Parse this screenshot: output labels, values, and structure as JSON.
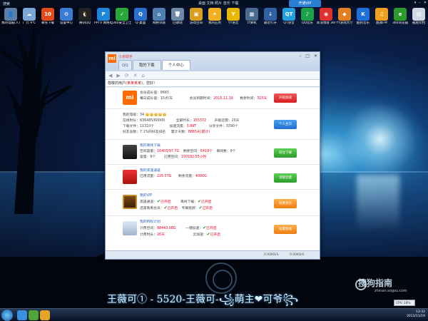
{
  "topbar": {
    "left": "搜索",
    "center": "桌面  文档  照片  音乐  下载",
    "vip": "开通VIP",
    "window_controls": [
      "▾",
      "–",
      "✕"
    ]
  },
  "desktop_icons": [
    {
      "label": "我的电脑(人)",
      "glyph": "👤",
      "color": "#5a7fa8"
    },
    {
      "label": "广元 9℃",
      "glyph": "☁",
      "color": "#7aa6d8"
    },
    {
      "label": "暴雪下载",
      "glyph": "10",
      "color": "#e24a1c"
    },
    {
      "label": "设置中心",
      "glyph": "⚙",
      "color": "#3b7bd4"
    },
    {
      "label": "腾讯QQ",
      "glyph": "🐧",
      "color": "#222"
    },
    {
      "label": "PPTV 网络电视",
      "glyph": "P",
      "color": "#1c86d8"
    },
    {
      "label": "360安全卫士",
      "glyph": "✓",
      "color": "#29a83a"
    },
    {
      "label": "Q-桌面",
      "glyph": "Q",
      "color": "#2a6fc9"
    },
    {
      "label": "网络邻居",
      "glyph": "⌂",
      "color": "#4f7fb0"
    },
    {
      "label": "回收站",
      "glyph": "🗑",
      "color": "#6e8aa8"
    },
    {
      "label": "游戏空间",
      "glyph": "▣",
      "color": "#d8a020"
    },
    {
      "label": "我的应用",
      "glyph": "✦",
      "color": "#f0b020"
    },
    {
      "label": "YY语音",
      "glyph": "Y",
      "color": "#e8b800"
    },
    {
      "label": "计算机",
      "glyph": "▦",
      "color": "#4a6a90"
    },
    {
      "label": "最近打开",
      "glyph": "↓",
      "color": "#3060a0"
    },
    {
      "label": "QT语音",
      "glyph": "QT",
      "color": "#24a0e0"
    },
    {
      "label": "QQ音乐",
      "glyph": "♪",
      "color": "#1ca048"
    },
    {
      "label": "新浪博客 360",
      "glyph": "◉",
      "color": "#e03030"
    },
    {
      "label": "YY游戏大厅",
      "glyph": "◆",
      "color": "#e08020"
    },
    {
      "label": "酷狗音乐",
      "glyph": "K",
      "color": "#1c70d8"
    },
    {
      "label": "酷我FM",
      "glyph": "♫",
      "color": "#f0a020"
    },
    {
      "label": "360浏览器",
      "glyph": "e",
      "color": "#2c9a2c"
    },
    {
      "label": "截图文档",
      "glyph": "▤",
      "color": "#cfd8e2"
    }
  ],
  "window": {
    "brand": "小米助手",
    "tabs": [
      "QQ",
      "我的下载",
      "个人中心"
    ],
    "toolbar_icons": [
      "◀",
      "▶",
      "⟳",
      "✕",
      "⌂"
    ],
    "address": {
      "prefix": "尊敬的用户(",
      "name": "某某某某",
      "suffix": ")，您好！"
    },
    "controls": [
      "–",
      "□",
      "✕"
    ],
    "account": {
      "member_level_label": "会员成长值：",
      "member_level": "8665",
      "daily_label": "每日成长值：",
      "daily": "15点/天",
      "expire_label": "会员到期时间：",
      "expire": "2015.11.19",
      "days_label": "剩余时间：",
      "days": "315天",
      "button": "升级加速"
    },
    "stats": {
      "level_label": "我的等级：",
      "level": "34",
      "crowns": "👑👑👑👑👑",
      "online_label": "在线时长：",
      "online": "636485/60000",
      "total_label": "全部时长：",
      "total": "155372",
      "up_label": "升级还需：",
      "up": "20天",
      "down_label": "下载文件：",
      "down": "11310个",
      "speed_label": "加速流量：",
      "speed": "3.89T",
      "share_label": "分享文件：",
      "share": "3390个",
      "fans_label": "好友总数：",
      "fans": "7.1%的好友排名",
      "total2_label": "累计天数：",
      "total2": "8865天(累计)",
      "button": "个人主页"
    },
    "offline": {
      "title": "我的离线下载",
      "a_label": "空间容量：",
      "a": "16403/97.7G",
      "b_label": "剩余空间：",
      "b": "6419个",
      "c_label": "离线数：",
      "c": "9个",
      "d_label": "容量：",
      "d": "9个",
      "e_label": "已用空间：",
      "e": "150182.55小时",
      "button": "前往下载"
    },
    "space": {
      "title": "我的高速通道",
      "a_label": "已用流量：",
      "a": "225.5TG",
      "b_label": "剩余流量：",
      "b": "4000G",
      "button": "领取流量"
    },
    "vip": {
      "title": "我的VIP",
      "items": [
        {
          "label": "高速通道：",
          "status": "已开启"
        },
        {
          "label": "离线下载：",
          "status": "已开启"
        },
        {
          "label": "迅雷看看会员：",
          "status": "已开启"
        },
        {
          "label": "专属铭牌：",
          "status": "已开启"
        }
      ],
      "button": "续费会员"
    },
    "privilege": {
      "title": "我的特权计划",
      "a_label": "计费空间：",
      "a": "88443.08G",
      "b_label": "计费时长：",
      "b": "26天",
      "c_label": "一键加速：",
      "c": "已开启",
      "d_label": "云加速：",
      "d": "已开启",
      "button": "设置加速"
    },
    "status": [
      "",
      "0.00KB/S",
      "0.00KB/S"
    ]
  },
  "lyric": "王薇可① - 5520-王薇可-꧁萌主❤可爷꧂",
  "watermark": {
    "brand": "搜狗指南",
    "url": "zhinan.sogou.com"
  },
  "cpu": "CPU 18%",
  "clock": {
    "time": "13:32",
    "date": "2013/11/19"
  }
}
